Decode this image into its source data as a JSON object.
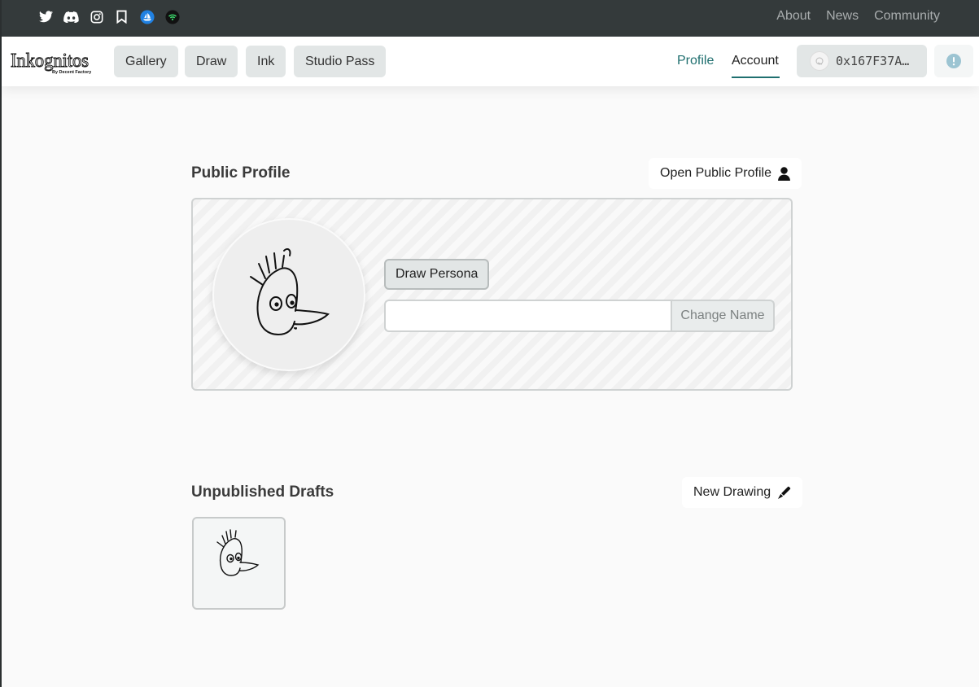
{
  "social_icons": [
    "twitter-icon",
    "discord-icon",
    "instagram-icon",
    "bookmark-icon",
    "opensea-icon",
    "signal-icon"
  ],
  "top_links": [
    "About",
    "News",
    "Community"
  ],
  "colors": {
    "topbar": "#343a3b",
    "accent": "#1f6f6f",
    "nav_button": "#e2e6e6",
    "info_icon": "#9cc4d2"
  },
  "logo": {
    "text": "Inkognitos",
    "sub": "By Decent Factory"
  },
  "nav": {
    "gallery": "Gallery",
    "draw": "Draw",
    "ink": "Ink",
    "studio_pass": "Studio Pass",
    "profile": "Profile",
    "account": "Account",
    "wallet_address": "0x167F37A…"
  },
  "public_profile": {
    "title": "Public Profile",
    "open_button": "Open Public Profile",
    "draw_persona": "Draw Persona",
    "name_value": "",
    "change_name": "Change Name"
  },
  "drafts": {
    "title": "Unpublished Drafts",
    "new_drawing": "New Drawing"
  }
}
